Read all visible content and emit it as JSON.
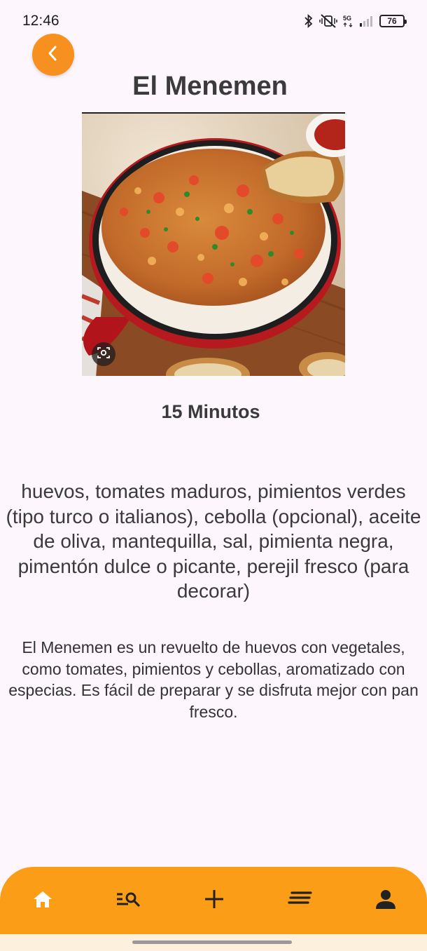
{
  "status_bar": {
    "time": "12:46",
    "network_label": "5G",
    "battery_level": "76",
    "icons": [
      "bluetooth-icon",
      "vibrate-off-icon",
      "network-5g-icon",
      "signal-icon",
      "battery-icon"
    ]
  },
  "header": {
    "back_icon": "chevron-left-icon",
    "title": "El Menemen"
  },
  "recipe": {
    "image_icon": "lens-icon",
    "time": "15 Minutos",
    "ingredients": "huevos, tomates maduros, pimientos verdes (tipo turco o italianos), cebolla (opcional), aceite de oliva, mantequilla, sal, pimienta negra, pimentón dulce o picante, perejil fresco (para decorar)",
    "description": "El Menemen es un revuelto de huevos con vegetales, como tomates, pimientos y cebollas, aromatizado con especias. Es fácil de preparar y se disfruta mejor con pan fresco."
  },
  "bottom_nav": {
    "items": [
      {
        "icon": "home-icon"
      },
      {
        "icon": "search-list-icon"
      },
      {
        "icon": "add-icon"
      },
      {
        "icon": "list-icon"
      },
      {
        "icon": "person-icon"
      }
    ]
  },
  "colors": {
    "accent": "#f7901e",
    "nav_background": "#fb9d17",
    "page_background": "#fdf7fd"
  }
}
